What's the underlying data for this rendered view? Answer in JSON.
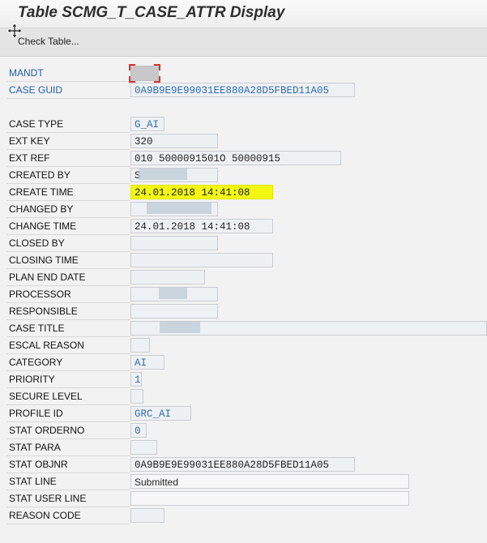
{
  "title": "Table SCMG_T_CASE_ATTR Display",
  "toolbar": {
    "check_table": "Check Table..."
  },
  "key_fields": [
    {
      "label": "MANDT",
      "value": ""
    },
    {
      "label": "CASE GUID",
      "value": "0A9B9E9E99031EE880A28D5FBED11A05"
    }
  ],
  "fields": [
    {
      "label": "CASE TYPE",
      "value": "G_AI"
    },
    {
      "label": "EXT KEY",
      "value": "320"
    },
    {
      "label": "EXT REF",
      "value": "010 5000091501O 50000915"
    },
    {
      "label": "CREATED BY",
      "value": "S"
    },
    {
      "label": "CREATE TIME",
      "value": "24.01.2018 14:41:08"
    },
    {
      "label": "CHANGED BY",
      "value": ""
    },
    {
      "label": "CHANGE TIME",
      "value": "24.01.2018 14:41:08"
    },
    {
      "label": "CLOSED BY",
      "value": ""
    },
    {
      "label": "CLOSING TIME",
      "value": ""
    },
    {
      "label": "PLAN END DATE",
      "value": ""
    },
    {
      "label": "PROCESSOR",
      "value": ""
    },
    {
      "label": "RESPONSIBLE",
      "value": ""
    },
    {
      "label": "CASE TITLE",
      "value": ""
    },
    {
      "label": "ESCAL REASON",
      "value": ""
    },
    {
      "label": "CATEGORY",
      "value": "AI"
    },
    {
      "label": "PRIORITY",
      "value": "1"
    },
    {
      "label": "SECURE LEVEL",
      "value": ""
    },
    {
      "label": "PROFILE ID",
      "value": "GRC_AI"
    },
    {
      "label": "STAT ORDERNO",
      "value": "0"
    },
    {
      "label": "STAT PARA",
      "value": ""
    },
    {
      "label": "STAT OBJNR",
      "value": "0A9B9E9E99031EE880A28D5FBED11A05"
    },
    {
      "label": "STAT LINE",
      "value": "Submitted"
    },
    {
      "label": "STAT USER LINE",
      "value": ""
    },
    {
      "label": "REASON CODE",
      "value": ""
    }
  ],
  "colors": {
    "highlight": "#f3f711",
    "key_label": "#1f5fae",
    "value_blue": "#2e6db4"
  }
}
